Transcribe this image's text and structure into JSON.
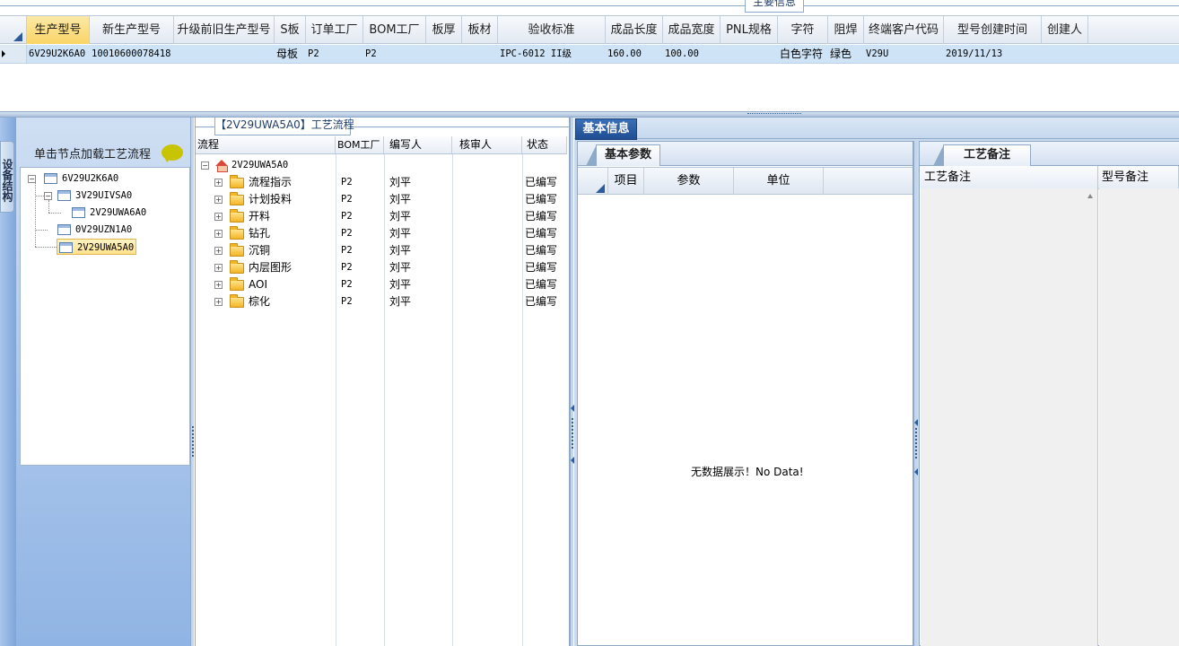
{
  "top": {
    "section_tab": "主要信息",
    "columns": [
      "生产型号",
      "新生产型号",
      "升级前旧生产型号",
      "S板",
      "订单工厂",
      "BOM工厂",
      "板厚",
      "板材",
      "验收标准",
      "成品长度",
      "成品宽度",
      "PNL规格",
      "字符",
      "阻焊",
      "终端客户代码",
      "型号创建时间",
      "创建人"
    ],
    "row": [
      "6V29U2K6A0",
      "10010600078418",
      "",
      "母板",
      "P2",
      "P2",
      "",
      "",
      "IPC-6012 II级",
      "160.00",
      "100.00",
      "",
      "白色字符",
      "绿色",
      "V29U",
      "2019/11/13",
      ""
    ]
  },
  "left": {
    "rail_label": "设备结构",
    "title": "单击节点加载工艺流程",
    "tree": [
      {
        "label": "6V29U2K6A0"
      },
      {
        "label": "3V29UIVSA0"
      },
      {
        "label": "2V29UWA6A0"
      },
      {
        "label": "0V29UZN1A0"
      },
      {
        "label": "2V29UWA5A0"
      }
    ]
  },
  "process": {
    "tab_title": "【2V29UWA5A0】工艺流程",
    "headers": [
      "流程",
      "BOM工厂",
      "编写人",
      "核审人",
      "状态"
    ],
    "root": "2V29UWA5A0",
    "rows": [
      {
        "name": "流程指示",
        "bom": "P2",
        "author": "刘平",
        "reviewer": "",
        "status": "已编写"
      },
      {
        "name": "计划投料",
        "bom": "P2",
        "author": "刘平",
        "reviewer": "",
        "status": "已编写"
      },
      {
        "name": "开料",
        "bom": "P2",
        "author": "刘平",
        "reviewer": "",
        "status": "已编写"
      },
      {
        "name": "钻孔",
        "bom": "P2",
        "author": "刘平",
        "reviewer": "",
        "status": "已编写"
      },
      {
        "name": "沉铜",
        "bom": "P2",
        "author": "刘平",
        "reviewer": "",
        "status": "已编写"
      },
      {
        "name": "内层图形",
        "bom": "P2",
        "author": "刘平",
        "reviewer": "",
        "status": "已编写"
      },
      {
        "name": "AOI",
        "bom": "P2",
        "author": "刘平",
        "reviewer": "",
        "status": "已编写"
      },
      {
        "name": "棕化",
        "bom": "P2",
        "author": "刘平",
        "reviewer": "",
        "status": "已编写"
      }
    ]
  },
  "right": {
    "main_tab": "基本信息",
    "params_tab": "基本参数",
    "params_headers": [
      "项目",
      "参数",
      "单位"
    ],
    "no_data": "无数据展示！No Data!",
    "remark_tab": "工艺备注",
    "remark_headers": [
      "工艺备注",
      "型号备注"
    ]
  }
}
